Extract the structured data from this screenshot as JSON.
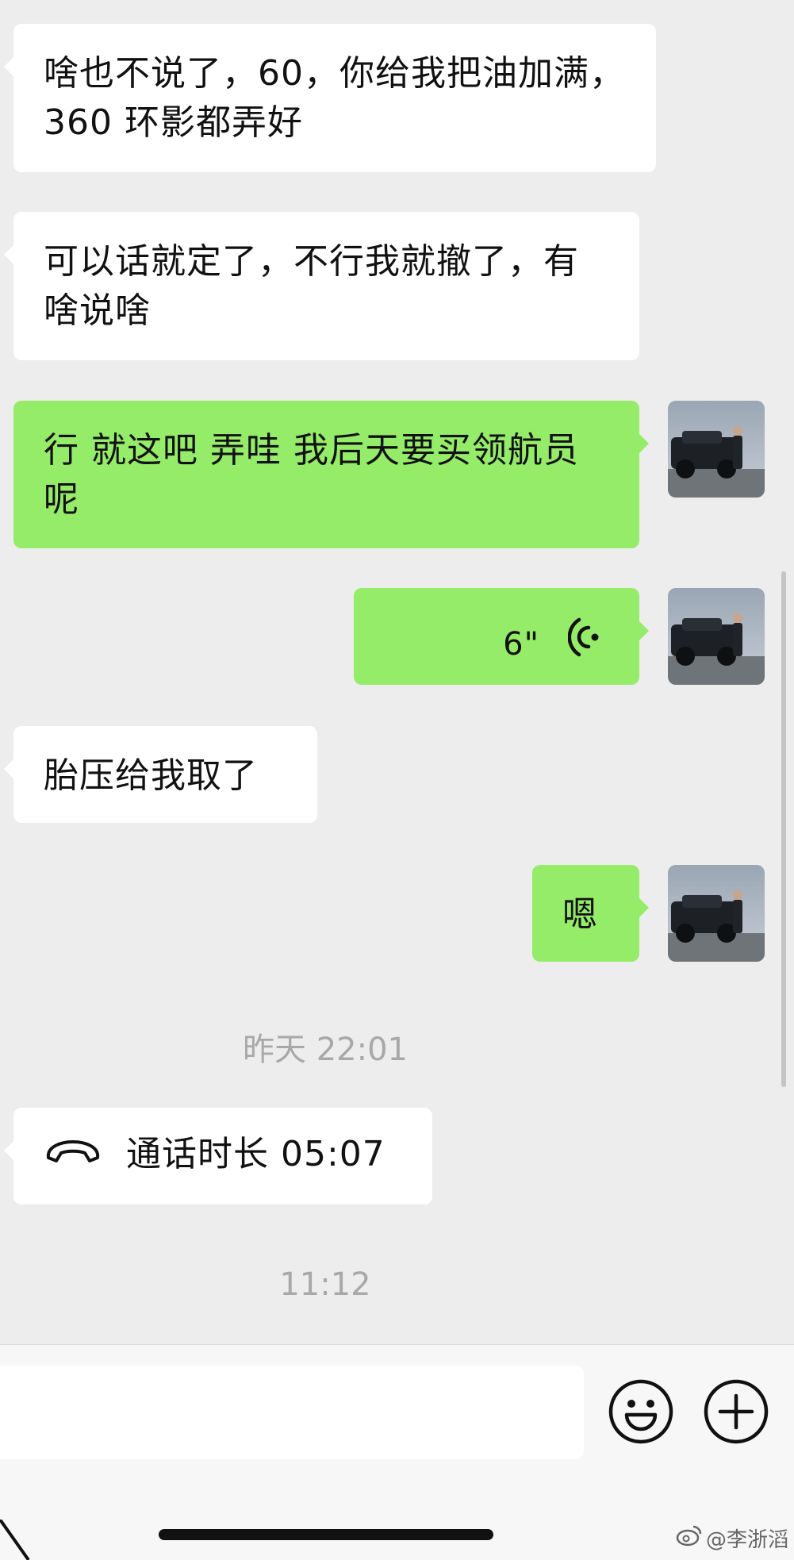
{
  "messages": [
    {
      "side": "in",
      "text": "啥也不说了，60，你给我把油加满，360 环影都弄好"
    },
    {
      "side": "in",
      "text": "可以话就定了，不行我就撤了，有啥说啥"
    },
    {
      "side": "out",
      "text": "行 就这吧 弄哇 我后天要买领航员呢"
    },
    {
      "side": "out",
      "type": "voice",
      "duration": "6\""
    },
    {
      "side": "in",
      "text": "胎压给我取了"
    },
    {
      "side": "out",
      "text": "嗯"
    }
  ],
  "timestamps": {
    "first": "昨天 22:01",
    "second": "11:12"
  },
  "call": {
    "icon": "phone-hangup-icon",
    "text": "通话时长 05:07"
  },
  "input_bar": {
    "emoji_icon": "emoji-icon",
    "plus_icon": "plus-icon"
  },
  "watermark": {
    "text": "@李浙滔"
  },
  "colors": {
    "background": "#ededed",
    "incoming_bubble": "#ffffff",
    "outgoing_bubble": "#95ec69",
    "timestamp": "#a8a8a8"
  }
}
